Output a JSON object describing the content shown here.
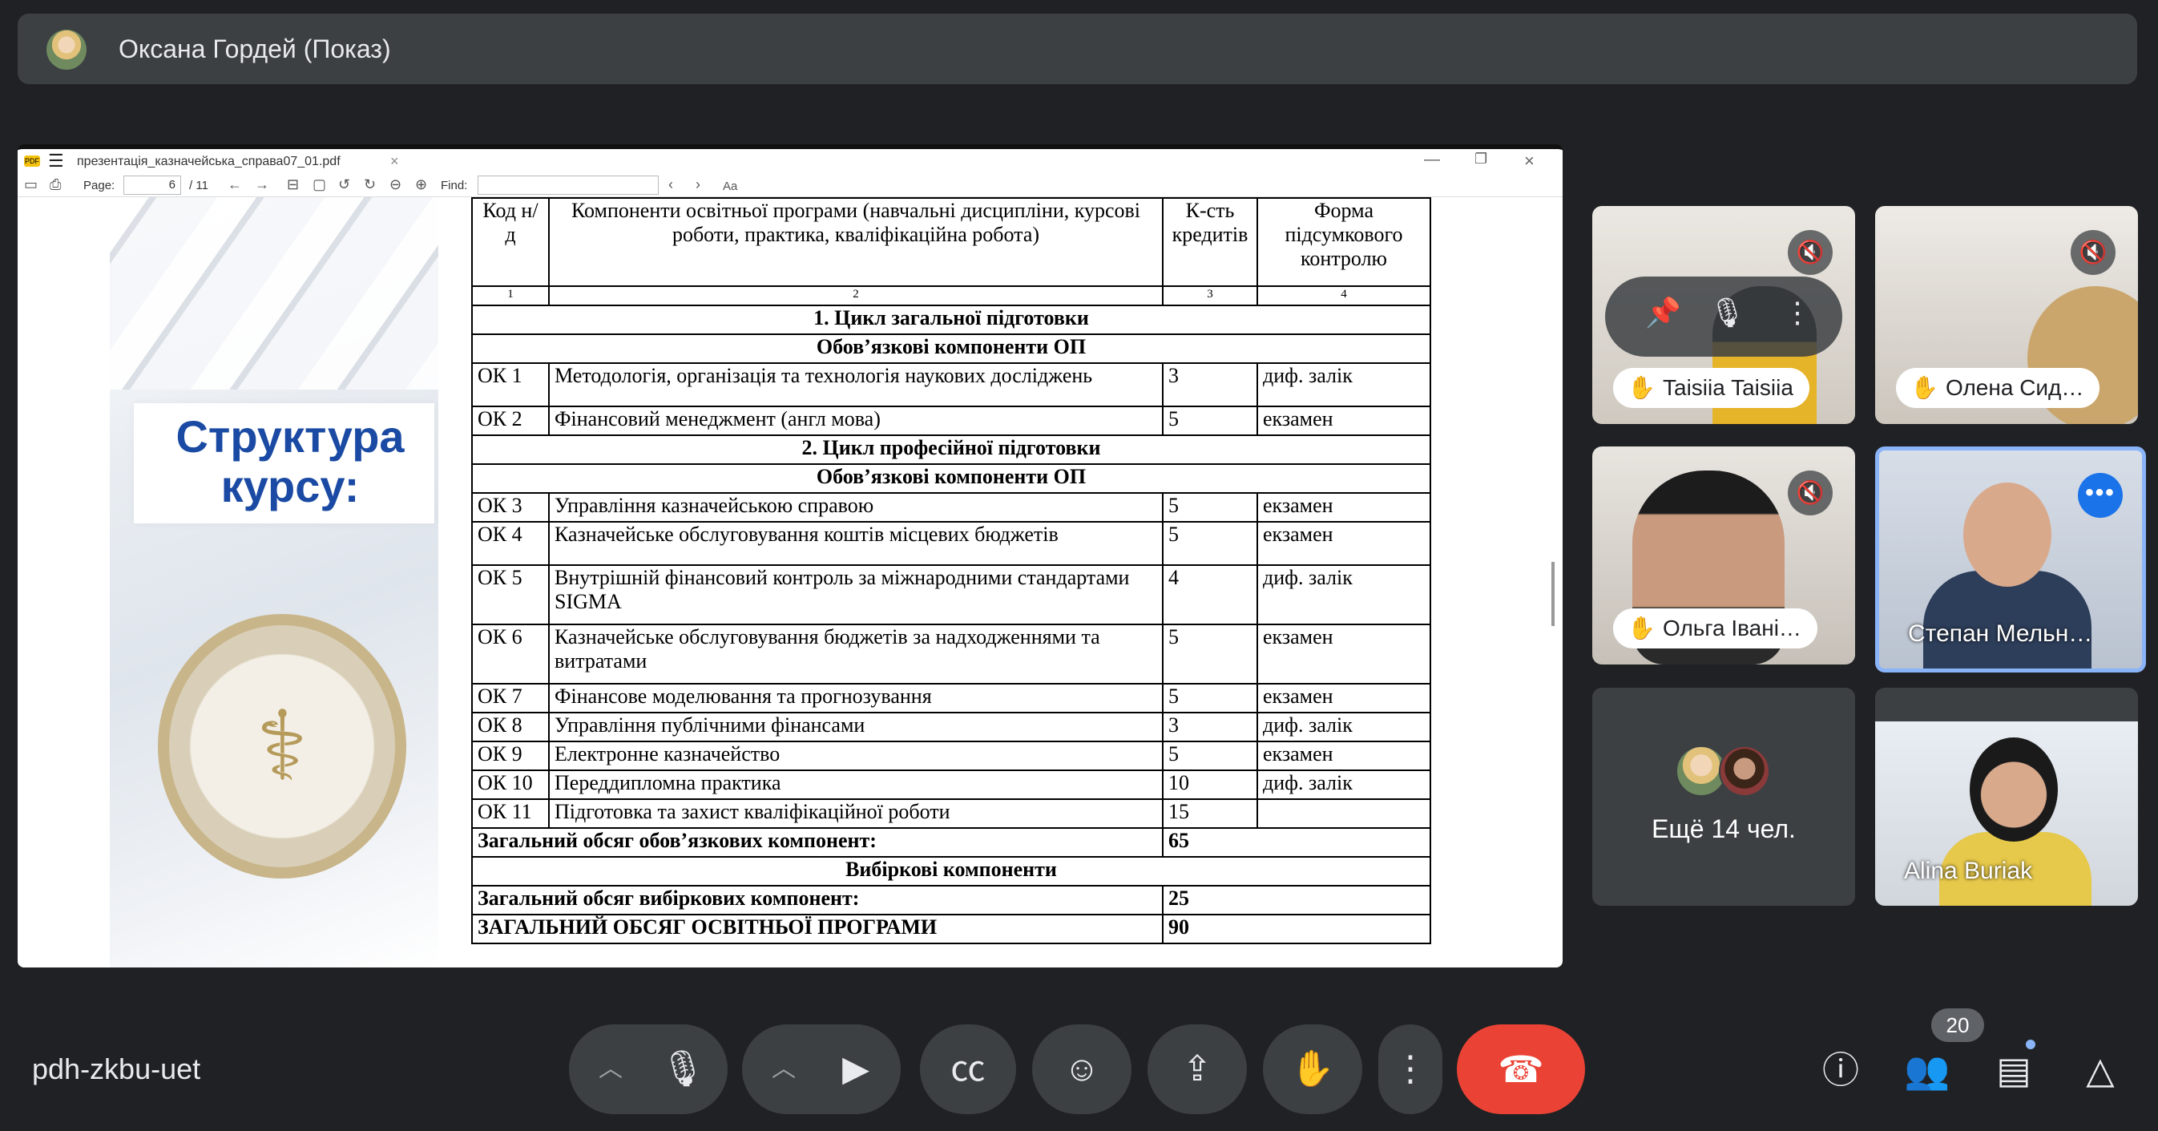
{
  "presenter": {
    "name": "Оксана Гордей (Показ)"
  },
  "pdf_viewer": {
    "app_icon": "PDF",
    "filename": "презентація_казначейська_справа07_01.pdf",
    "page_label": "Page:",
    "page_value": "6",
    "page_total": "/ 11",
    "find_label": "Find:",
    "find_placeholder": "",
    "aa_label": "Aa"
  },
  "slide": {
    "title": "Структура курсу:"
  },
  "doc_table": {
    "header": {
      "col1": "Код н/д",
      "col2": "Компоненти освітньої програми (навчальні дисципліни, курсові роботи, практика, кваліфікаційна робота)",
      "col3": "К-сть кредитів",
      "col4": "Форма підсумкового контролю",
      "n1": "1",
      "n2": "2",
      "n3": "3",
      "n4": "4"
    },
    "cycle1": "1. Цикл загальної підготовки",
    "mandatory1": "Обов’язкові компоненти ОП",
    "rows1": [
      {
        "code": "ОК 1",
        "name": "Методологія, організація та технологія наукових досліджень",
        "credits": "3",
        "form": "диф. залік"
      },
      {
        "code": "ОК 2",
        "name": "Фінансовий менеджмент (англ мова)",
        "credits": "5",
        "form": "екзамен"
      }
    ],
    "cycle2": "2. Цикл професійної підготовки",
    "mandatory2": "Обов’язкові компоненти ОП",
    "rows2": [
      {
        "code": "ОК 3",
        "name": "Управління казначейською справою",
        "credits": "5",
        "form": "екзамен"
      },
      {
        "code": "ОК 4",
        "name": "Казначейське обслуговування коштів місцевих бюджетів",
        "credits": "5",
        "form": "екзамен"
      },
      {
        "code": "ОК 5",
        "name": "Внутрішній фінансовий контроль за міжнародними стандартами SIGMA",
        "credits": "4",
        "form": "диф. залік"
      },
      {
        "code": "ОК 6",
        "name": "Казначейське обслуговування бюджетів за надходженнями та витратами",
        "credits": "5",
        "form": "екзамен"
      },
      {
        "code": "ОК 7",
        "name": "Фінансове моделювання та прогнозування",
        "credits": "5",
        "form": "екзамен"
      },
      {
        "code": "ОК 8",
        "name": "Управління публічними фінансами",
        "credits": "3",
        "form": "диф. залік"
      },
      {
        "code": "ОК 9",
        "name": "Електронне казначейство",
        "credits": "5",
        "form": "екзамен"
      },
      {
        "code": "ОК 10",
        "name": "Переддипломна практика",
        "credits": "10",
        "form": "диф. залік"
      },
      {
        "code": "ОК 11",
        "name": "Підготовка та захист кваліфікаційної роботи",
        "credits": "15",
        "form": ""
      }
    ],
    "total_mandatory_label": "Загальний обсяг обов’язкових компонент:",
    "total_mandatory_value": "65",
    "elective_header": "Вибіркові компоненти",
    "total_elective_label": "Загальний обсяг вибіркових компонент:",
    "total_elective_value": "25",
    "total_program_label": "ЗАГАЛЬНИЙ ОБСЯГ ОСВІТНЬОЇ ПРОГРАМИ",
    "total_program_value": "90"
  },
  "participants": {
    "tile1": {
      "name": "Taisiia Taisiia",
      "hand": "✋"
    },
    "tile2": {
      "name": "Олена Сид…",
      "hand": "✋"
    },
    "tile3": {
      "name": "Ольга Івані…",
      "hand": "✋"
    },
    "tile4": {
      "name": "Степан Мельн…"
    },
    "more": {
      "label": "Ещё 14 чел."
    },
    "tile6": {
      "name": "Alina Buriak"
    }
  },
  "bottom_bar": {
    "meeting_code": "pdh-zkbu-uet",
    "people_count": "20"
  },
  "colors": {
    "background": "#202124",
    "surface": "#3c4043",
    "hangup": "#ea4335",
    "accent": "#8ab4f8",
    "speaking": "#1a73e8",
    "slide_title": "#1a4aa3"
  },
  "icons": {
    "mic": "microphone-icon",
    "camera": "camera-icon",
    "captions": "captions-icon",
    "emoji": "emoji-icon",
    "present": "present-screen-icon",
    "hand": "raise-hand-icon",
    "more": "more-options-icon",
    "hangup": "hangup-icon",
    "info": "info-icon",
    "people": "people-icon",
    "chat": "chat-icon",
    "activities": "activities-icon"
  }
}
